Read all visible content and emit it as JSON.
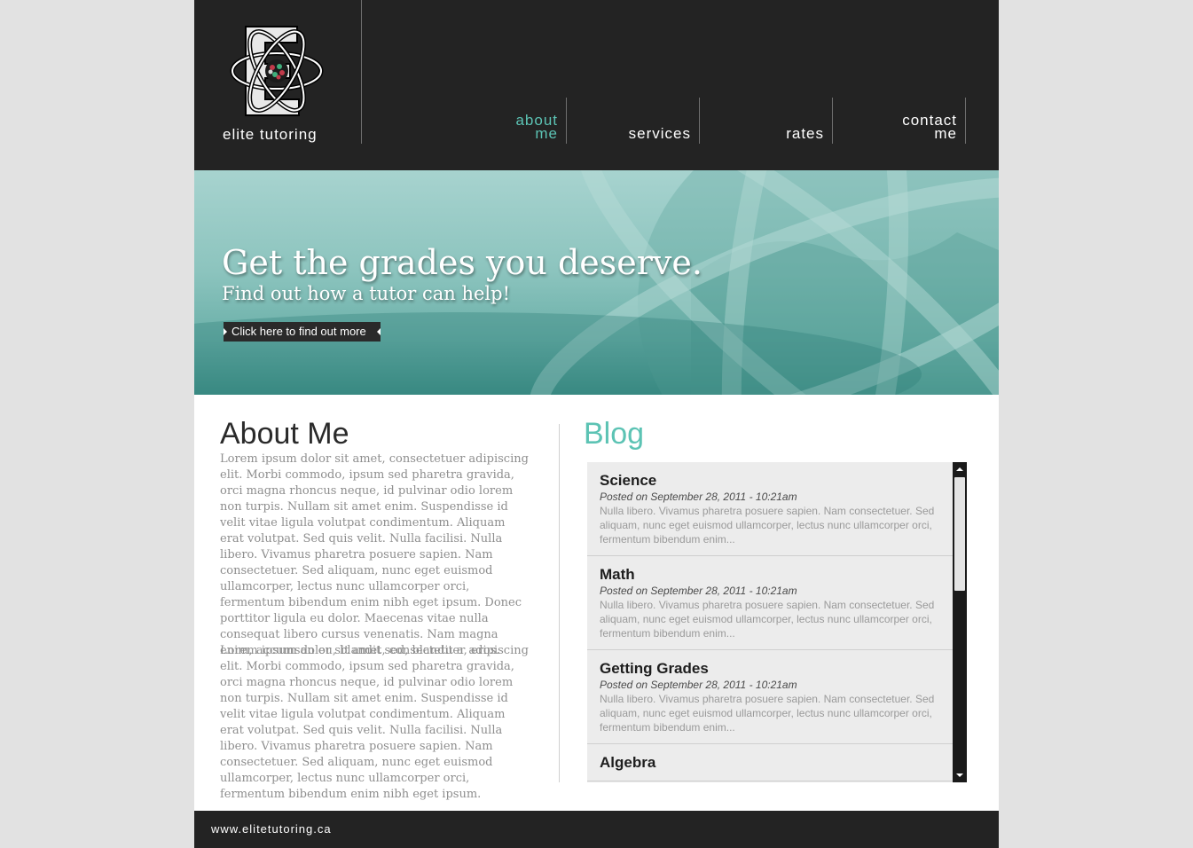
{
  "brand": {
    "logo_text": "elite tutoring"
  },
  "nav": {
    "items": [
      {
        "line1": "about",
        "line2": "me",
        "active": true
      },
      {
        "line1": "",
        "line2": "services",
        "active": false
      },
      {
        "line1": "",
        "line2": "rates",
        "active": false
      },
      {
        "line1": "contact",
        "line2": "me",
        "active": false
      }
    ]
  },
  "hero": {
    "title": "Get the grades you deserve.",
    "subtitle": "Find out how a tutor can help!",
    "button_label": "Click here to find out more"
  },
  "about": {
    "title": "About Me",
    "paragraphs": [
      "Lorem ipsum dolor sit amet, consectetuer adipiscing elit. Morbi commodo, ipsum sed pharetra gravida, orci magna rhoncus neque, id pulvinar odio lorem non turpis. Nullam sit amet enim. Suspendisse id velit vitae ligula volutpat condimentum. Aliquam erat volutpat. Sed quis velit. Nulla facilisi. Nulla libero. Vivamus pharetra posuere sapien. Nam consectetuer. Sed aliquam, nunc eget euismod ullamcorper, lectus nunc ullamcorper orci, fermentum bibendum enim nibh eget ipsum. Donec porttitor ligula eu dolor. Maecenas vitae nulla consequat libero cursus venenatis. Nam magna enim, accumsan eu, blandit sed, blandit a, eros.",
      "Lorem ipsum dolor sit amet, consectetuer adipiscing elit. Morbi commodo, ipsum sed pharetra gravida, orci magna rhoncus neque, id pulvinar odio lorem non turpis. Nullam sit amet enim. Suspendisse id velit vitae ligula volutpat condimentum. Aliquam erat volutpat. Sed quis velit. Nulla facilisi. Nulla libero. Vivamus pharetra posuere sapien. Nam consectetuer. Sed aliquam, nunc eget euismod ullamcorper, lectus nunc ullamcorper orci, fermentum bibendum enim nibh eget ipsum."
    ]
  },
  "blog": {
    "title": "Blog",
    "posts": [
      {
        "title": "Science",
        "date": "Posted on September 28, 2011 - 10:21am",
        "excerpt": "Nulla libero. Vivamus pharetra posuere sapien. Nam consectetuer. Sed aliquam, nunc eget euismod ullamcorper, lectus nunc ullamcorper orci, fermentum bibendum enim..."
      },
      {
        "title": "Math",
        "date": "Posted on September 28, 2011 - 10:21am",
        "excerpt": "Nulla libero. Vivamus pharetra posuere sapien. Nam consectetuer. Sed aliquam, nunc eget euismod ullamcorper, lectus nunc ullamcorper orci, fermentum bibendum enim..."
      },
      {
        "title": "Getting Grades",
        "date": "Posted on September 28, 2011 - 10:21am",
        "excerpt": "Nulla libero. Vivamus pharetra posuere sapien. Nam consectetuer. Sed aliquam, nunc eget euismod ullamcorper, lectus nunc ullamcorper orci, fermentum bibendum enim..."
      },
      {
        "title": "Algebra",
        "date": "",
        "excerpt": ""
      }
    ]
  },
  "footer": {
    "url": "www.elitetutoring.ca"
  },
  "colors": {
    "accent": "#5cc3b4",
    "dark": "#232323",
    "background": "#e2e2e2"
  },
  "icons": {
    "logo": "atom-e-logo-icon",
    "scroll_up": "triangle-up-icon",
    "scroll_down": "triangle-down-icon",
    "button_arrow": "triangle-right-icon"
  }
}
